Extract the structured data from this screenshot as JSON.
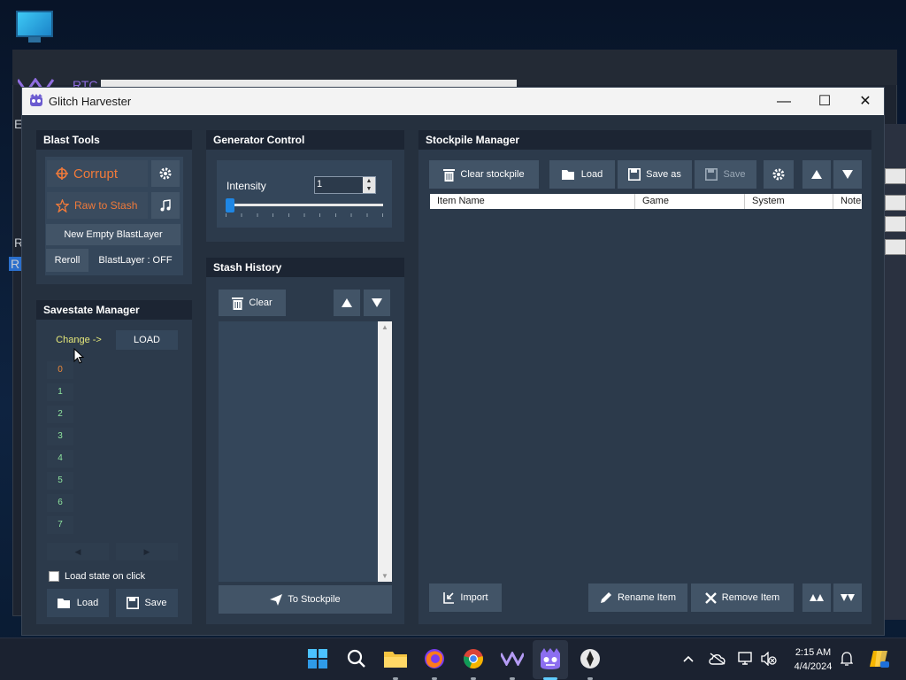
{
  "window": {
    "title": "Glitch Harvester"
  },
  "background_window": {
    "title_fragment": "RTC",
    "side_letters": [
      "E",
      "R",
      "R"
    ]
  },
  "blast_tools": {
    "title": "Blast Tools",
    "corrupt": "Corrupt",
    "raw_to_stash": "Raw to Stash",
    "new_empty_blastlayer": "New Empty BlastLayer",
    "reroll": "Reroll",
    "blastlayer_status": "BlastLayer : OFF"
  },
  "generator_control": {
    "title": "Generator Control",
    "intensity_label": "Intensity",
    "intensity_value": "1",
    "intensity_slider_fraction": 0.0
  },
  "savestate_manager": {
    "title": "Savestate Manager",
    "change": "Change ->",
    "load_top": "LOAD",
    "slots": [
      "0",
      "1",
      "2",
      "3",
      "4",
      "5",
      "6",
      "7"
    ],
    "active_slot": "0",
    "load_on_click": "Load state on click",
    "load": "Load",
    "save": "Save"
  },
  "stash_history": {
    "title": "Stash History",
    "clear": "Clear",
    "to_stockpile": "To Stockpile"
  },
  "stockpile_manager": {
    "title": "Stockpile Manager",
    "clear_stockpile": "Clear stockpile",
    "load": "Load",
    "save_as": "Save as",
    "save": "Save",
    "columns": [
      "Item Name",
      "Game",
      "System",
      "Note"
    ],
    "import": "Import",
    "rename_item": "Rename Item",
    "remove_item": "Remove Item"
  },
  "taskbar": {
    "time": "2:15 AM",
    "date": "4/4/2024"
  },
  "colors": {
    "panel": "#2c3a4b",
    "header": "#1c2533",
    "button": "#425467",
    "corrupt_text": "#f07a3a",
    "slot_text": "#8fe59f",
    "accent": "#2b8de0"
  }
}
